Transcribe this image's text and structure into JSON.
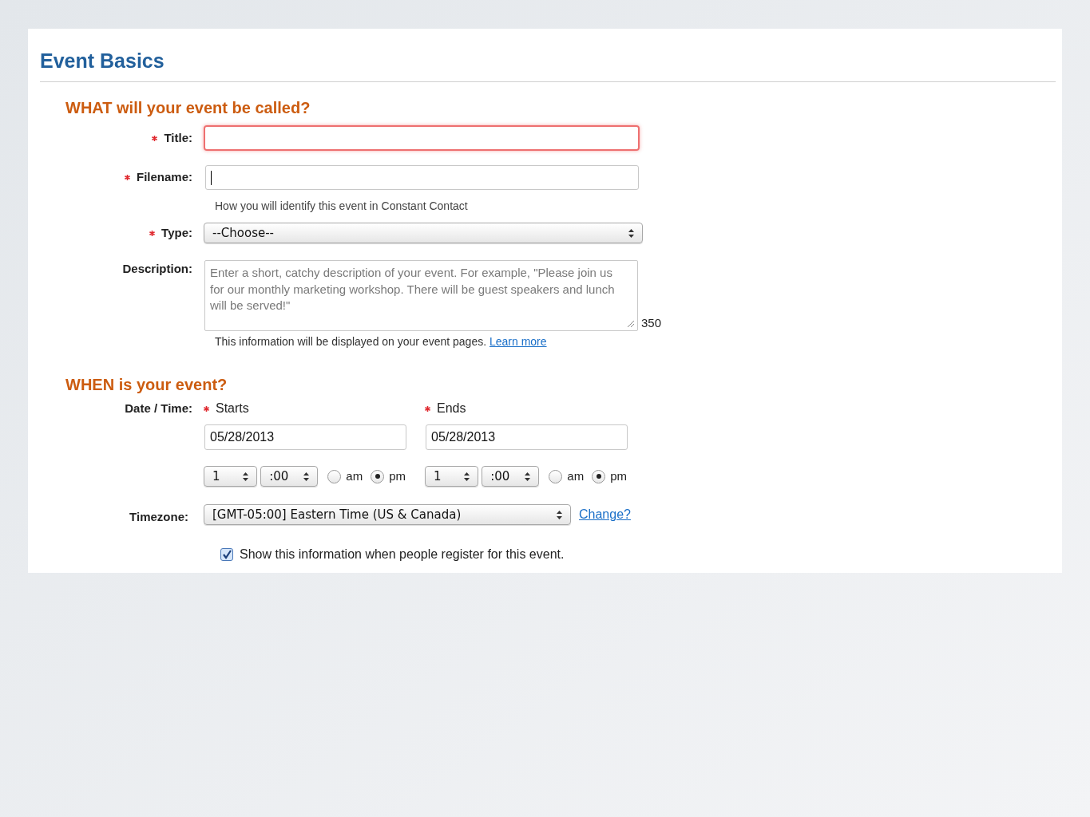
{
  "title": "Event Basics",
  "what": {
    "heading": "WHAT will your event be called?",
    "title_field": {
      "label": "Title:",
      "required": true,
      "invalid": true
    },
    "filename_field": {
      "label": "Filename:",
      "required": true,
      "focused": true,
      "hint": "How you will identify this event in Constant Contact"
    },
    "type_field": {
      "label": "Type:",
      "required": true,
      "value": "--Choose--"
    },
    "description_field": {
      "label": "Description:",
      "required": false,
      "placeholder": "Enter a short, catchy description of your event. For example, \"Please join us for our monthly marketing workshop. There will be guest speakers and lunch will be served!\"",
      "counter": "350",
      "hint": "This information will be displayed on your event pages.",
      "link": "Learn more"
    }
  },
  "when": {
    "heading": "WHEN is your event?",
    "datetime_label": "Date / Time:",
    "times": [
      {
        "label": "Starts",
        "required": true,
        "date": "05/28/2013",
        "hour": "1",
        "minute": ":00",
        "periods": [
          {
            "label": "am",
            "selected": false
          },
          {
            "label": "pm",
            "selected": true
          }
        ]
      },
      {
        "label": "Ends",
        "required": true,
        "date": "05/28/2013",
        "hour": "1",
        "minute": ":00",
        "periods": [
          {
            "label": "am",
            "selected": false
          },
          {
            "label": "pm",
            "selected": true
          }
        ]
      }
    ],
    "timezone": {
      "label": "Timezone:",
      "value": "[GMT-05:00] Eastern Time (US & Canada)",
      "link": "Change?"
    },
    "show_info": {
      "label": "Show this information when people register for this event.",
      "checked": true
    }
  }
}
